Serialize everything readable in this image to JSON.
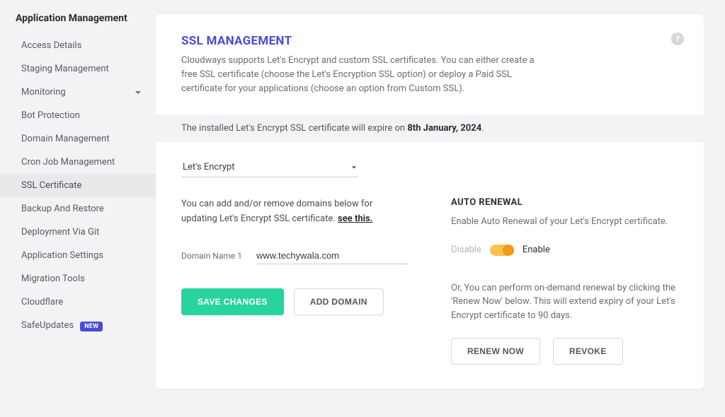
{
  "sidebar": {
    "title": "Application Management",
    "items": [
      {
        "label": "Access Details"
      },
      {
        "label": "Staging Management"
      },
      {
        "label": "Monitoring",
        "expandable": true
      },
      {
        "label": "Bot Protection"
      },
      {
        "label": "Domain Management"
      },
      {
        "label": "Cron Job Management"
      },
      {
        "label": "SSL Certificate",
        "active": true
      },
      {
        "label": "Backup And Restore"
      },
      {
        "label": "Deployment Via Git"
      },
      {
        "label": "Application Settings"
      },
      {
        "label": "Migration Tools"
      },
      {
        "label": "Cloudflare"
      },
      {
        "label": "SafeUpdates",
        "badge": "NEW"
      }
    ]
  },
  "header": {
    "title": "SSL MANAGEMENT",
    "description": "Cloudways supports Let's Encrypt and custom SSL certificates. You can either create a free SSL certificate (choose the Let's Encryption SSL option) or deploy a Paid SSL certificate for your applications (choose an option from Custom SSL)."
  },
  "expire_notice": {
    "prefix": "The installed Let's Encrypt SSL certificate will expire on ",
    "date": "8th January, 2024",
    "suffix": "."
  },
  "provider_dropdown": {
    "selected": "Let's Encrypt"
  },
  "domain_section": {
    "description_prefix": "You can add and/or remove domains below for updating Let's Encrypt SSL certificate. ",
    "link_text": "see this.",
    "field_label": "Domain Name 1",
    "field_value": "www.techywala.com",
    "save_button": "SAVE CHANGES",
    "add_button": "ADD DOMAIN"
  },
  "auto_renewal": {
    "title": "AUTO RENEWAL",
    "description": "Enable Auto Renewal of your Let's Encrypt certificate.",
    "disable_label": "Disable",
    "enable_label": "Enable",
    "renew_description": "Or, You can perform on-demand renewal by clicking the 'Renew Now' below. This will extend expiry of your Let's Encrypt certificate to 90 days.",
    "renew_button": "RENEW NOW",
    "revoke_button": "REVOKE"
  },
  "icons": {
    "help": "?",
    "chevron_down": "▾"
  }
}
